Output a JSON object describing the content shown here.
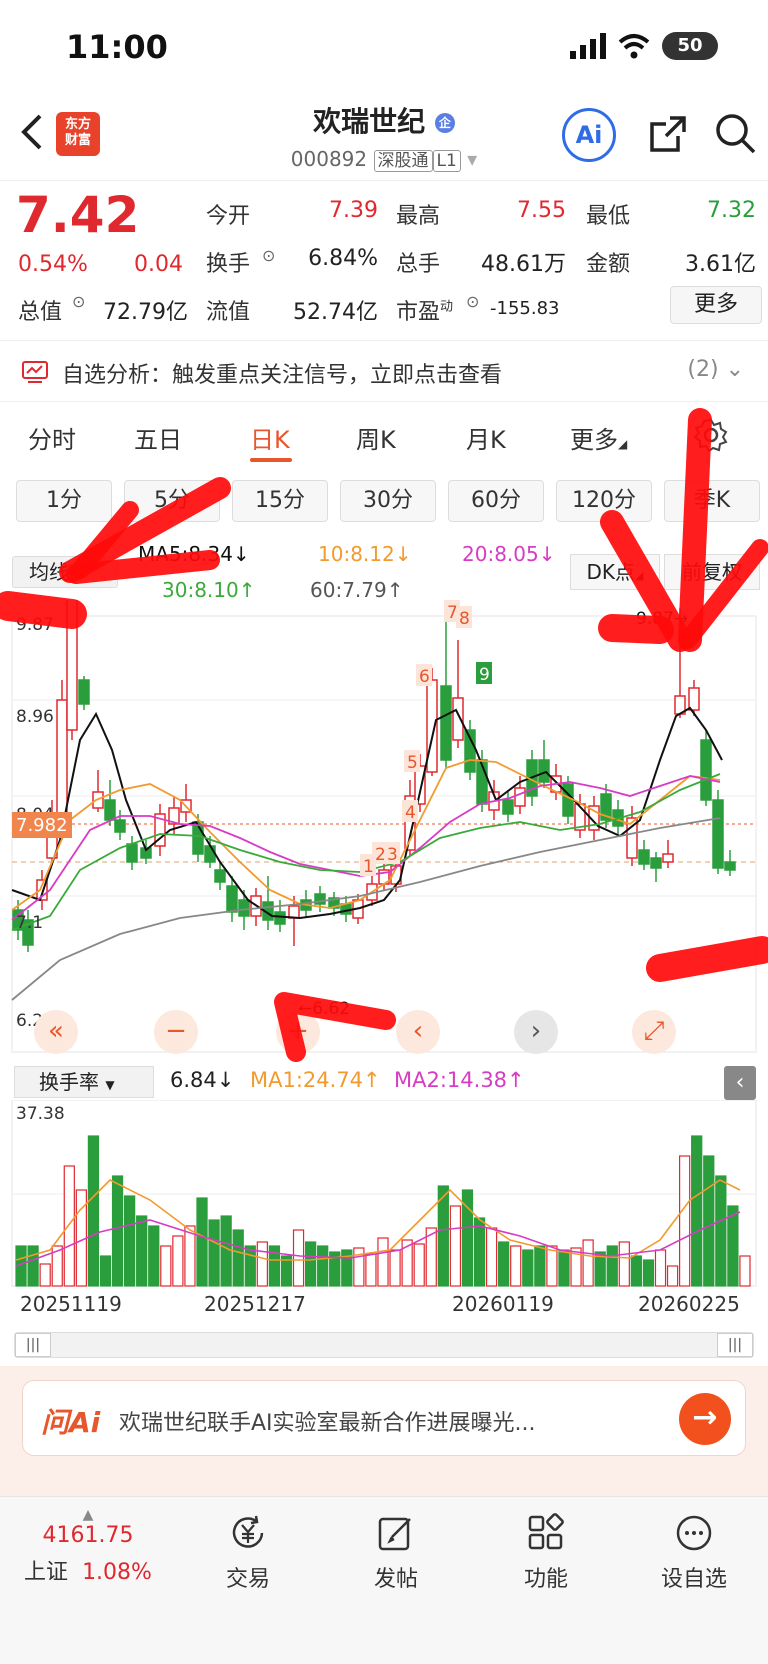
{
  "status": {
    "time": "11:00",
    "battery": "50"
  },
  "header": {
    "name": "欢瑞世纪",
    "code": "000892",
    "market": "深股通",
    "level": "L1",
    "logo_line1": "东方",
    "logo_line2": "财富",
    "ai_label": "Ai"
  },
  "quote": {
    "price": "7.42",
    "pct": "0.54%",
    "chg": "0.04",
    "open_label": "今开",
    "open": "7.39",
    "high_label": "最高",
    "high": "7.55",
    "low_label": "最低",
    "low": "7.32",
    "turnover_label": "换手",
    "turnover": "6.84%",
    "volume_label": "总手",
    "volume": "48.61万",
    "amount_label": "金额",
    "amount": "3.61亿",
    "mktcap_label": "总值",
    "mktcap": "72.79亿",
    "float_label": "流值",
    "float": "52.74亿",
    "pe_label": "市盈",
    "pe_sup": "动",
    "pe": "-155.83",
    "more": "更多"
  },
  "signal": {
    "text": "自选分析：触发重点关注信号，立即点击查看",
    "count": "(2)"
  },
  "tabs": [
    "分时",
    "五日",
    "日K",
    "周K",
    "月K",
    "更多"
  ],
  "periods": [
    "1分",
    "5分",
    "15分",
    "30分",
    "60分",
    "120分",
    "季K"
  ],
  "ma_legend": {
    "selector": "均线",
    "ma5": "MA5:8.34↓",
    "ma10": "10:8.12↓",
    "ma20": "20:8.05↓",
    "ma30": "30:8.10↑",
    "ma60": "60:7.79↑",
    "dk": "DK点",
    "fq": "前复权"
  },
  "kline": {
    "y_labels": [
      "9.87",
      "8.96",
      "8.04",
      "7.982",
      "7.1",
      "6.22"
    ],
    "high_mark": "9.87",
    "low_mark": "6.62",
    "signal_numbers": [
      "1",
      "2",
      "3",
      "4",
      "5",
      "6",
      "7",
      "8",
      "9"
    ]
  },
  "turnover_legend": {
    "selector": "换手率",
    "value": "6.84↓",
    "ma1": "MA1:24.74↑",
    "ma2": "MA2:14.38↑",
    "max": "37.38"
  },
  "dates": [
    "20251119",
    "20251217",
    "20260119",
    "20260225"
  ],
  "ai_bar": {
    "logo": "问Ai",
    "text": "欢瑞世纪联手AI实验室最新合作进展曝光..."
  },
  "bottom": {
    "index_value": "4161.75",
    "index_name": "上证",
    "index_pct": "1.08%",
    "trade": "交易",
    "post": "发帖",
    "function": "功能",
    "watch": "设自选"
  },
  "colors": {
    "up": "#e0282f",
    "down": "#2a9d3c",
    "accent": "#e8562b",
    "ma5": "#111111",
    "ma10": "#f29a2e",
    "ma20": "#d63cc4",
    "ma30": "#3aaa3a",
    "ma60": "#888888"
  }
}
